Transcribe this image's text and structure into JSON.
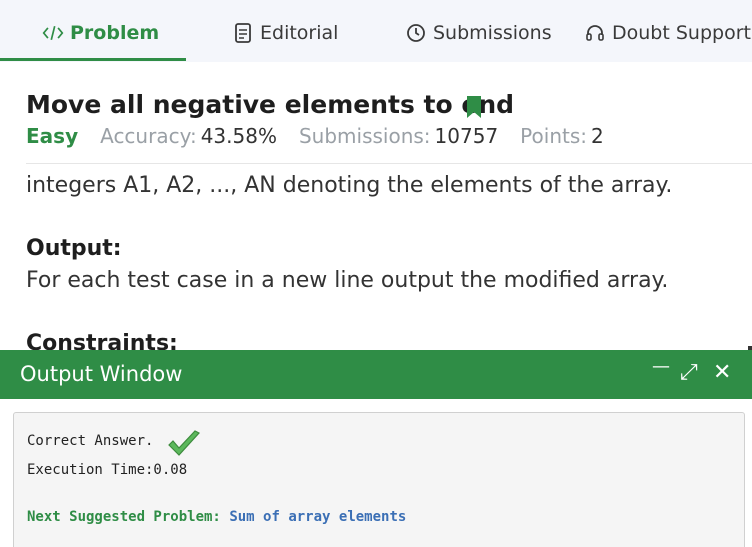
{
  "tabs": {
    "problem": "Problem",
    "editorial": "Editorial",
    "submissions": "Submissions",
    "doubt_support": "Doubt Support"
  },
  "problem": {
    "title": "Move all negative elements to end",
    "difficulty": "Easy",
    "accuracy_label": "Accuracy:",
    "accuracy_value": "43.58%",
    "submissions_label": "Submissions:",
    "submissions_value": "10757",
    "points_label": "Points:",
    "points_value": "2"
  },
  "body": {
    "line1": "integers A1, A2, ..., AN denoting the elements of the array.",
    "output_heading": "Output:",
    "output_text": "For each test case in a new line output the modified array.",
    "constraints_heading": "Constraints:"
  },
  "output_window": {
    "title": "Output Window",
    "minimize": "—",
    "expand": "⤢",
    "close": "✕",
    "result": "Correct Answer.",
    "execution_time": "Execution Time:0.08",
    "next_label": "Next Suggested Problem:",
    "next_problem": "Sum of array  elements"
  },
  "colors": {
    "accent": "#2f8d46",
    "link": "#3b6fb5",
    "muted": "#9aa0a6"
  },
  "icons": {
    "problem": "code-icon",
    "editorial": "document-icon",
    "submissions": "clock-icon",
    "doubt_support": "headset-icon",
    "bookmark": "bookmark-icon",
    "check": "checkmark-icon"
  }
}
